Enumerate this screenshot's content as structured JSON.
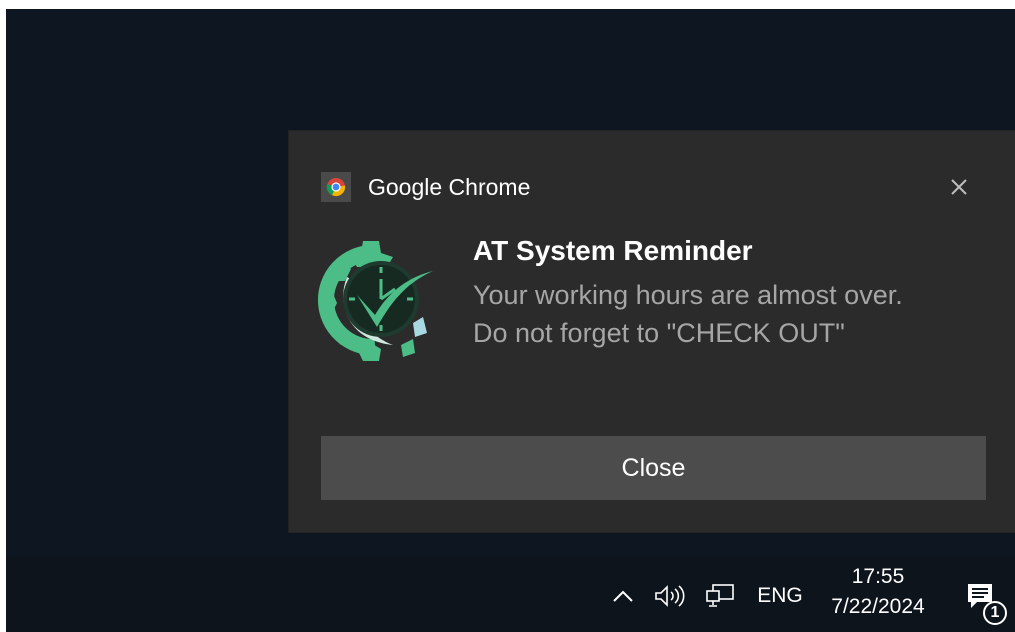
{
  "notification": {
    "app_name": "Google Chrome",
    "app_icon": "chrome-icon",
    "dismiss_icon": "close-icon",
    "logo_icon": "gear-clock-checkmark-icon",
    "title": "AT System Reminder",
    "body_line1": "Your working hours are almost over.",
    "body_line2": "Do not forget to \"CHECK OUT\"",
    "action_label": "Close"
  },
  "taskbar": {
    "show_hidden_icon": "chevron-up-icon",
    "volume_icon": "speaker-icon",
    "network_icon": "network-icon",
    "language": "ENG",
    "time": "17:55",
    "date": "7/22/2024",
    "action_center_icon": "notification-icon",
    "notification_count": "1"
  },
  "colors": {
    "desktop_bg": "#0e1621",
    "toast_bg": "#2b2b2b",
    "button_bg": "#4c4c4c",
    "logo_green": "#4dbd88",
    "logo_dark": "#2f5a45"
  }
}
